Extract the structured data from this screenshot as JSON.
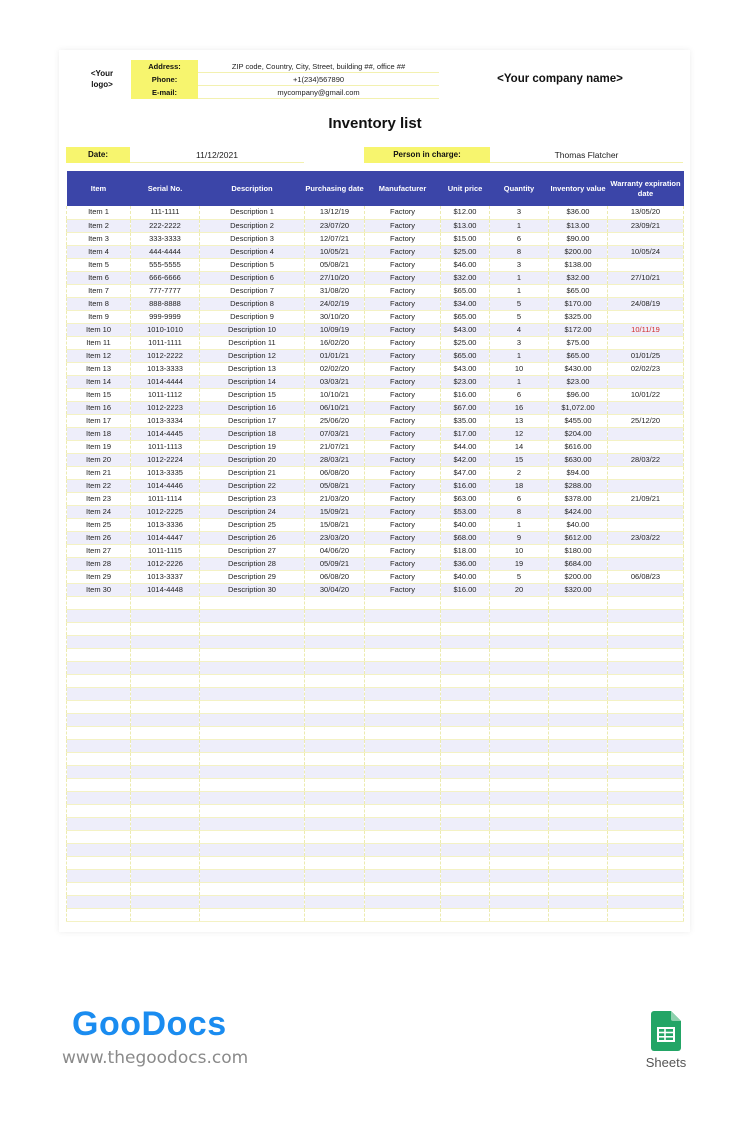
{
  "header": {
    "logo_placeholder": "<Your logo>",
    "company_name": "<Your company name>",
    "contact": [
      {
        "label": "Address:",
        "value": "ZIP code, Country, City, Street, building ##, office ##"
      },
      {
        "label": "Phone:",
        "value": "+1(234)567890"
      },
      {
        "label": "E-mail:",
        "value": "mycompany@gmail.com"
      }
    ]
  },
  "document": {
    "title": "Inventory list",
    "date_label": "Date:",
    "date_value": "11/12/2021",
    "person_label": "Person in charge:",
    "person_value": "Thomas Flatcher"
  },
  "colors": {
    "header_blue": "#3b45a8",
    "accent_yellow": "#f7f56e",
    "row_alt": "#eeeefa",
    "overdue_red": "#d22b2b",
    "brand_blue": "#1a8cf0",
    "sheets_green": "#23a566"
  },
  "table": {
    "columns": [
      "Item",
      "Serial No.",
      "Description",
      "Purchasing date",
      "Manufacturer",
      "Unit price",
      "Quantity",
      "Inventory value",
      "Warranty expiration date"
    ],
    "rows": [
      [
        "Item 1",
        "111-1111",
        "Description 1",
        "13/12/19",
        "Factory",
        "$12.00",
        "3",
        "$36.00",
        "13/05/20"
      ],
      [
        "Item 2",
        "222-2222",
        "Description 2",
        "23/07/20",
        "Factory",
        "$13.00",
        "1",
        "$13.00",
        "23/09/21"
      ],
      [
        "Item 3",
        "333-3333",
        "Description 3",
        "12/07/21",
        "Factory",
        "$15.00",
        "6",
        "$90.00",
        ""
      ],
      [
        "Item 4",
        "444-4444",
        "Description 4",
        "10/05/21",
        "Factory",
        "$25.00",
        "8",
        "$200.00",
        "10/05/24"
      ],
      [
        "Item 5",
        "555-5555",
        "Description 5",
        "05/08/21",
        "Factory",
        "$46.00",
        "3",
        "$138.00",
        ""
      ],
      [
        "Item 6",
        "666-6666",
        "Description 6",
        "27/10/20",
        "Factory",
        "$32.00",
        "1",
        "$32.00",
        "27/10/21"
      ],
      [
        "Item 7",
        "777-7777",
        "Description 7",
        "31/08/20",
        "Factory",
        "$65.00",
        "1",
        "$65.00",
        ""
      ],
      [
        "Item 8",
        "888-8888",
        "Description 8",
        "24/02/19",
        "Factory",
        "$34.00",
        "5",
        "$170.00",
        "24/08/19"
      ],
      [
        "Item 9",
        "999-9999",
        "Description 9",
        "30/10/20",
        "Factory",
        "$65.00",
        "5",
        "$325.00",
        ""
      ],
      [
        "Item 10",
        "1010-1010",
        "Description 10",
        "10/09/19",
        "Factory",
        "$43.00",
        "4",
        "$172.00",
        "10/11/19"
      ],
      [
        "Item 11",
        "1011-1111",
        "Description 11",
        "16/02/20",
        "Factory",
        "$25.00",
        "3",
        "$75.00",
        ""
      ],
      [
        "Item 12",
        "1012-2222",
        "Description 12",
        "01/01/21",
        "Factory",
        "$65.00",
        "1",
        "$65.00",
        "01/01/25"
      ],
      [
        "Item 13",
        "1013-3333",
        "Description 13",
        "02/02/20",
        "Factory",
        "$43.00",
        "10",
        "$430.00",
        "02/02/23"
      ],
      [
        "Item 14",
        "1014-4444",
        "Description 14",
        "03/03/21",
        "Factory",
        "$23.00",
        "1",
        "$23.00",
        ""
      ],
      [
        "Item 15",
        "1011-1112",
        "Description 15",
        "10/10/21",
        "Factory",
        "$16.00",
        "6",
        "$96.00",
        "10/01/22"
      ],
      [
        "Item 16",
        "1012-2223",
        "Description 16",
        "06/10/21",
        "Factory",
        "$67.00",
        "16",
        "$1,072.00",
        ""
      ],
      [
        "Item 17",
        "1013-3334",
        "Description 17",
        "25/06/20",
        "Factory",
        "$35.00",
        "13",
        "$455.00",
        "25/12/20"
      ],
      [
        "Item 18",
        "1014-4445",
        "Description 18",
        "07/03/21",
        "Factory",
        "$17.00",
        "12",
        "$204.00",
        ""
      ],
      [
        "Item 19",
        "1011-1113",
        "Description 19",
        "21/07/21",
        "Factory",
        "$44.00",
        "14",
        "$616.00",
        ""
      ],
      [
        "Item 20",
        "1012-2224",
        "Description 20",
        "28/03/21",
        "Factory",
        "$42.00",
        "15",
        "$630.00",
        "28/03/22"
      ],
      [
        "Item 21",
        "1013-3335",
        "Description 21",
        "06/08/20",
        "Factory",
        "$47.00",
        "2",
        "$94.00",
        ""
      ],
      [
        "Item 22",
        "1014-4446",
        "Description 22",
        "05/08/21",
        "Factory",
        "$16.00",
        "18",
        "$288.00",
        ""
      ],
      [
        "Item 23",
        "1011-1114",
        "Description 23",
        "21/03/20",
        "Factory",
        "$63.00",
        "6",
        "$378.00",
        "21/09/21"
      ],
      [
        "Item 24",
        "1012-2225",
        "Description 24",
        "15/09/21",
        "Factory",
        "$53.00",
        "8",
        "$424.00",
        ""
      ],
      [
        "Item 25",
        "1013-3336",
        "Description 25",
        "15/08/21",
        "Factory",
        "$40.00",
        "1",
        "$40.00",
        ""
      ],
      [
        "Item 26",
        "1014-4447",
        "Description 26",
        "23/03/20",
        "Factory",
        "$68.00",
        "9",
        "$612.00",
        "23/03/22"
      ],
      [
        "Item 27",
        "1011-1115",
        "Description 27",
        "04/06/20",
        "Factory",
        "$18.00",
        "10",
        "$180.00",
        ""
      ],
      [
        "Item 28",
        "1012-2226",
        "Description 28",
        "05/09/21",
        "Factory",
        "$36.00",
        "19",
        "$684.00",
        ""
      ],
      [
        "Item 29",
        "1013-3337",
        "Description 29",
        "06/08/20",
        "Factory",
        "$40.00",
        "5",
        "$200.00",
        "06/08/23"
      ],
      [
        "Item 30",
        "1014-4448",
        "Description 30",
        "30/04/20",
        "Factory",
        "$16.00",
        "20",
        "$320.00",
        ""
      ]
    ],
    "overdue_rows": [
      9
    ],
    "empty_rows": 25
  },
  "branding": {
    "brand_name": "GooDocs",
    "url": "www.thegoodocs.com",
    "app_label": "Sheets",
    "app_icon": "google-sheets-icon"
  }
}
